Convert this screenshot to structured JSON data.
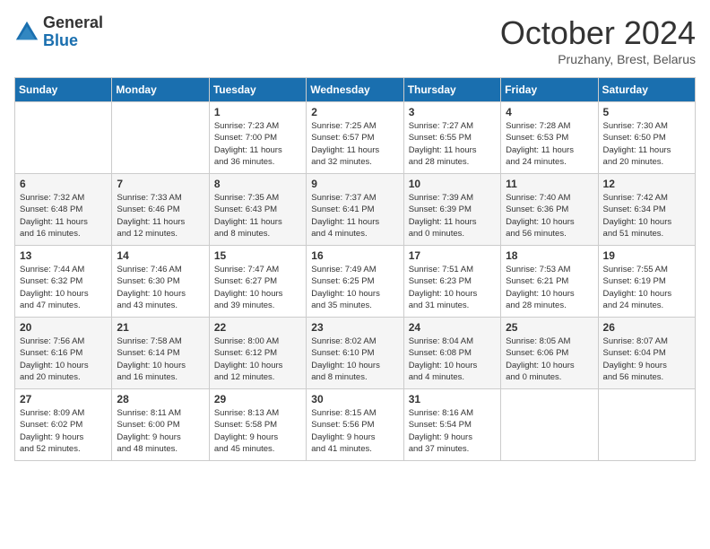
{
  "logo": {
    "general": "General",
    "blue": "Blue"
  },
  "title": "October 2024",
  "subtitle": "Pruzhany, Brest, Belarus",
  "days_header": [
    "Sunday",
    "Monday",
    "Tuesday",
    "Wednesday",
    "Thursday",
    "Friday",
    "Saturday"
  ],
  "weeks": [
    [
      {
        "day": "",
        "info": ""
      },
      {
        "day": "",
        "info": ""
      },
      {
        "day": "1",
        "info": "Sunrise: 7:23 AM\nSunset: 7:00 PM\nDaylight: 11 hours\nand 36 minutes."
      },
      {
        "day": "2",
        "info": "Sunrise: 7:25 AM\nSunset: 6:57 PM\nDaylight: 11 hours\nand 32 minutes."
      },
      {
        "day": "3",
        "info": "Sunrise: 7:27 AM\nSunset: 6:55 PM\nDaylight: 11 hours\nand 28 minutes."
      },
      {
        "day": "4",
        "info": "Sunrise: 7:28 AM\nSunset: 6:53 PM\nDaylight: 11 hours\nand 24 minutes."
      },
      {
        "day": "5",
        "info": "Sunrise: 7:30 AM\nSunset: 6:50 PM\nDaylight: 11 hours\nand 20 minutes."
      }
    ],
    [
      {
        "day": "6",
        "info": "Sunrise: 7:32 AM\nSunset: 6:48 PM\nDaylight: 11 hours\nand 16 minutes."
      },
      {
        "day": "7",
        "info": "Sunrise: 7:33 AM\nSunset: 6:46 PM\nDaylight: 11 hours\nand 12 minutes."
      },
      {
        "day": "8",
        "info": "Sunrise: 7:35 AM\nSunset: 6:43 PM\nDaylight: 11 hours\nand 8 minutes."
      },
      {
        "day": "9",
        "info": "Sunrise: 7:37 AM\nSunset: 6:41 PM\nDaylight: 11 hours\nand 4 minutes."
      },
      {
        "day": "10",
        "info": "Sunrise: 7:39 AM\nSunset: 6:39 PM\nDaylight: 11 hours\nand 0 minutes."
      },
      {
        "day": "11",
        "info": "Sunrise: 7:40 AM\nSunset: 6:36 PM\nDaylight: 10 hours\nand 56 minutes."
      },
      {
        "day": "12",
        "info": "Sunrise: 7:42 AM\nSunset: 6:34 PM\nDaylight: 10 hours\nand 51 minutes."
      }
    ],
    [
      {
        "day": "13",
        "info": "Sunrise: 7:44 AM\nSunset: 6:32 PM\nDaylight: 10 hours\nand 47 minutes."
      },
      {
        "day": "14",
        "info": "Sunrise: 7:46 AM\nSunset: 6:30 PM\nDaylight: 10 hours\nand 43 minutes."
      },
      {
        "day": "15",
        "info": "Sunrise: 7:47 AM\nSunset: 6:27 PM\nDaylight: 10 hours\nand 39 minutes."
      },
      {
        "day": "16",
        "info": "Sunrise: 7:49 AM\nSunset: 6:25 PM\nDaylight: 10 hours\nand 35 minutes."
      },
      {
        "day": "17",
        "info": "Sunrise: 7:51 AM\nSunset: 6:23 PM\nDaylight: 10 hours\nand 31 minutes."
      },
      {
        "day": "18",
        "info": "Sunrise: 7:53 AM\nSunset: 6:21 PM\nDaylight: 10 hours\nand 28 minutes."
      },
      {
        "day": "19",
        "info": "Sunrise: 7:55 AM\nSunset: 6:19 PM\nDaylight: 10 hours\nand 24 minutes."
      }
    ],
    [
      {
        "day": "20",
        "info": "Sunrise: 7:56 AM\nSunset: 6:16 PM\nDaylight: 10 hours\nand 20 minutes."
      },
      {
        "day": "21",
        "info": "Sunrise: 7:58 AM\nSunset: 6:14 PM\nDaylight: 10 hours\nand 16 minutes."
      },
      {
        "day": "22",
        "info": "Sunrise: 8:00 AM\nSunset: 6:12 PM\nDaylight: 10 hours\nand 12 minutes."
      },
      {
        "day": "23",
        "info": "Sunrise: 8:02 AM\nSunset: 6:10 PM\nDaylight: 10 hours\nand 8 minutes."
      },
      {
        "day": "24",
        "info": "Sunrise: 8:04 AM\nSunset: 6:08 PM\nDaylight: 10 hours\nand 4 minutes."
      },
      {
        "day": "25",
        "info": "Sunrise: 8:05 AM\nSunset: 6:06 PM\nDaylight: 10 hours\nand 0 minutes."
      },
      {
        "day": "26",
        "info": "Sunrise: 8:07 AM\nSunset: 6:04 PM\nDaylight: 9 hours\nand 56 minutes."
      }
    ],
    [
      {
        "day": "27",
        "info": "Sunrise: 8:09 AM\nSunset: 6:02 PM\nDaylight: 9 hours\nand 52 minutes."
      },
      {
        "day": "28",
        "info": "Sunrise: 8:11 AM\nSunset: 6:00 PM\nDaylight: 9 hours\nand 48 minutes."
      },
      {
        "day": "29",
        "info": "Sunrise: 8:13 AM\nSunset: 5:58 PM\nDaylight: 9 hours\nand 45 minutes."
      },
      {
        "day": "30",
        "info": "Sunrise: 8:15 AM\nSunset: 5:56 PM\nDaylight: 9 hours\nand 41 minutes."
      },
      {
        "day": "31",
        "info": "Sunrise: 8:16 AM\nSunset: 5:54 PM\nDaylight: 9 hours\nand 37 minutes."
      },
      {
        "day": "",
        "info": ""
      },
      {
        "day": "",
        "info": ""
      }
    ]
  ]
}
